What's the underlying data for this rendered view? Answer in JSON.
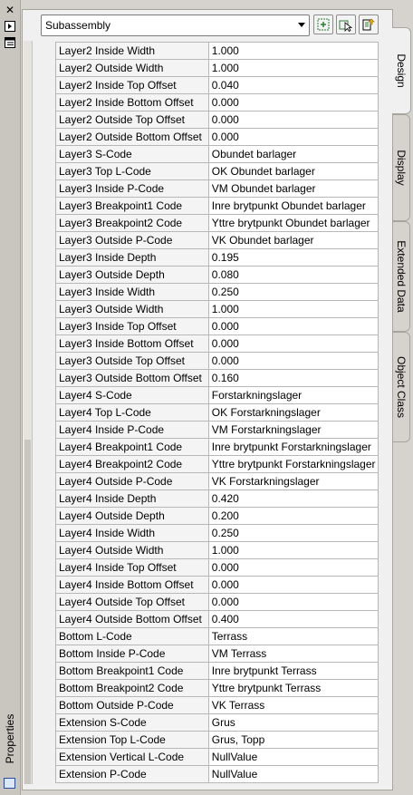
{
  "palette": {
    "title": "Properties",
    "object_type": "Subassembly"
  },
  "tabs": [
    {
      "label": "Design"
    },
    {
      "label": "Display"
    },
    {
      "label": "Extended Data"
    },
    {
      "label": "Object Class"
    }
  ],
  "toolbar": {
    "buttons": [
      {
        "icon": "quick-select-icon"
      },
      {
        "icon": "select-objects-icon"
      },
      {
        "icon": "toggle-pickadd-icon"
      }
    ]
  },
  "rows": [
    {
      "name": "Layer2 Inside Width",
      "value": "1.000"
    },
    {
      "name": "Layer2 Outside Width",
      "value": "1.000"
    },
    {
      "name": "Layer2 Inside Top Offset",
      "value": "0.040"
    },
    {
      "name": "Layer2 Inside Bottom Offset",
      "value": "0.000"
    },
    {
      "name": "Layer2 Outside Top Offset",
      "value": "0.000"
    },
    {
      "name": "Layer2 Outside Bottom Offset",
      "value": "0.000"
    },
    {
      "name": "Layer3 S-Code",
      "value": "Obundet barlager"
    },
    {
      "name": "Layer3 Top L-Code",
      "value": "OK Obundet barlager"
    },
    {
      "name": "Layer3 Inside P-Code",
      "value": "VM Obundet barlager"
    },
    {
      "name": "Layer3 Breakpoint1 Code",
      "value": "Inre brytpunkt Obundet barlager"
    },
    {
      "name": "Layer3 Breakpoint2 Code",
      "value": "Yttre brytpunkt Obundet barlager"
    },
    {
      "name": "Layer3 Outside P-Code",
      "value": "VK Obundet barlager"
    },
    {
      "name": "Layer3 Inside Depth",
      "value": "0.195"
    },
    {
      "name": "Layer3 Outside Depth",
      "value": "0.080"
    },
    {
      "name": "Layer3 Inside Width",
      "value": "0.250"
    },
    {
      "name": "Layer3 Outside Width",
      "value": "1.000"
    },
    {
      "name": "Layer3 Inside Top Offset",
      "value": "0.000"
    },
    {
      "name": "Layer3 Inside Bottom Offset",
      "value": "0.000"
    },
    {
      "name": "Layer3 Outside Top Offset",
      "value": "0.000"
    },
    {
      "name": "Layer3 Outside Bottom Offset",
      "value": "0.160"
    },
    {
      "name": "Layer4 S-Code",
      "value": "Forstarkningslager"
    },
    {
      "name": "Layer4 Top L-Code",
      "value": "OK Forstarkningslager"
    },
    {
      "name": "Layer4 Inside P-Code",
      "value": "VM Forstarkningslager"
    },
    {
      "name": "Layer4 Breakpoint1 Code",
      "value": "Inre brytpunkt Forstarkningslager"
    },
    {
      "name": "Layer4 Breakpoint2 Code",
      "value": "Yttre brytpunkt Forstarkningslager"
    },
    {
      "name": "Layer4 Outside P-Code",
      "value": "VK Forstarkningslager"
    },
    {
      "name": "Layer4 Inside Depth",
      "value": "0.420"
    },
    {
      "name": "Layer4 Outside Depth",
      "value": "0.200"
    },
    {
      "name": "Layer4 Inside Width",
      "value": "0.250"
    },
    {
      "name": "Layer4 Outside Width",
      "value": "1.000"
    },
    {
      "name": "Layer4 Inside Top Offset",
      "value": "0.000"
    },
    {
      "name": "Layer4 Inside Bottom Offset",
      "value": "0.000"
    },
    {
      "name": "Layer4 Outside Top Offset",
      "value": "0.000"
    },
    {
      "name": "Layer4 Outside Bottom Offset",
      "value": "0.400"
    },
    {
      "name": "Bottom L-Code",
      "value": "Terrass"
    },
    {
      "name": "Bottom Inside P-Code",
      "value": "VM Terrass"
    },
    {
      "name": "Bottom Breakpoint1 Code",
      "value": "Inre brytpunkt Terrass"
    },
    {
      "name": "Bottom Breakpoint2 Code",
      "value": "Yttre brytpunkt Terrass"
    },
    {
      "name": "Bottom Outside P-Code",
      "value": "VK Terrass"
    },
    {
      "name": "Extension S-Code",
      "value": "Grus"
    },
    {
      "name": "Extension Top L-Code",
      "value": "Grus, Topp"
    },
    {
      "name": "Extension Vertical L-Code",
      "value": "NullValue"
    },
    {
      "name": "Extension P-Code",
      "value": "NullValue"
    }
  ]
}
